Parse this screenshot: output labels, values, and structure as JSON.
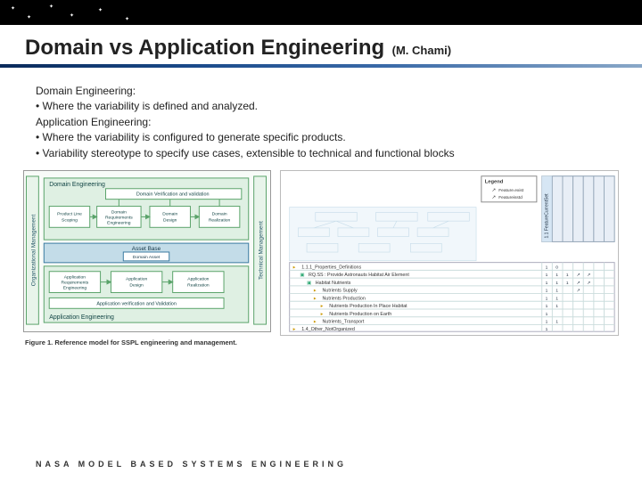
{
  "title": "Domain vs Application Engineering",
  "attribution": "(M. Chami)",
  "body": {
    "sec1_label": "Domain Engineering:",
    "sec1_b1": "• Where the variability is defined and analyzed.",
    "sec2_label": "Application Engineering:",
    "sec2_b1": "• Where the variability is configured to generate specific products.",
    "sec2_b2": "• Variability stereotype to specify use cases, extensible to technical and functional blocks"
  },
  "fig_left": {
    "domain_eng": "Domain Engineering",
    "dom_vv": "Domain Verification and validation",
    "pls": "Product Line Scoping",
    "dre": "Domain Requirements Engineering",
    "dd": "Domain Design",
    "dr": "Domain Realization",
    "asset_base": "Asset Base",
    "da": "Domain Asset",
    "are": "Application Requirements Engineering",
    "ad": "Application Design",
    "ar": "Application Realization",
    "app_vv": "Application verification and Validation",
    "app_eng": "Application Engineering",
    "side_left": "Organizational Management",
    "side_right": "Technical Management",
    "caption": "Figure 1. Reference model for SSPL engineering and management."
  },
  "fig_right": {
    "legend_title": "Legend",
    "legend_fea": "Feature.exist",
    "legend_fs": "Featureisstd",
    "col_head": "1.1  FeatureCurrentSet",
    "row_items": [
      "1.1.1_Properties_Definitions",
      "RQ.SS : Provide Astronauts Habitat Air Element",
      "Habitat Nutrients",
      "Nutrients Supply",
      "Nutrients Production",
      "Nutrients Production In Place Habitat",
      "Nutrients Production on Earth",
      "Nutrients_Transport",
      "1.4_Other_NotOrganized"
    ]
  },
  "footer": "NASA MODEL BASED SYSTEMS ENGINEERING"
}
